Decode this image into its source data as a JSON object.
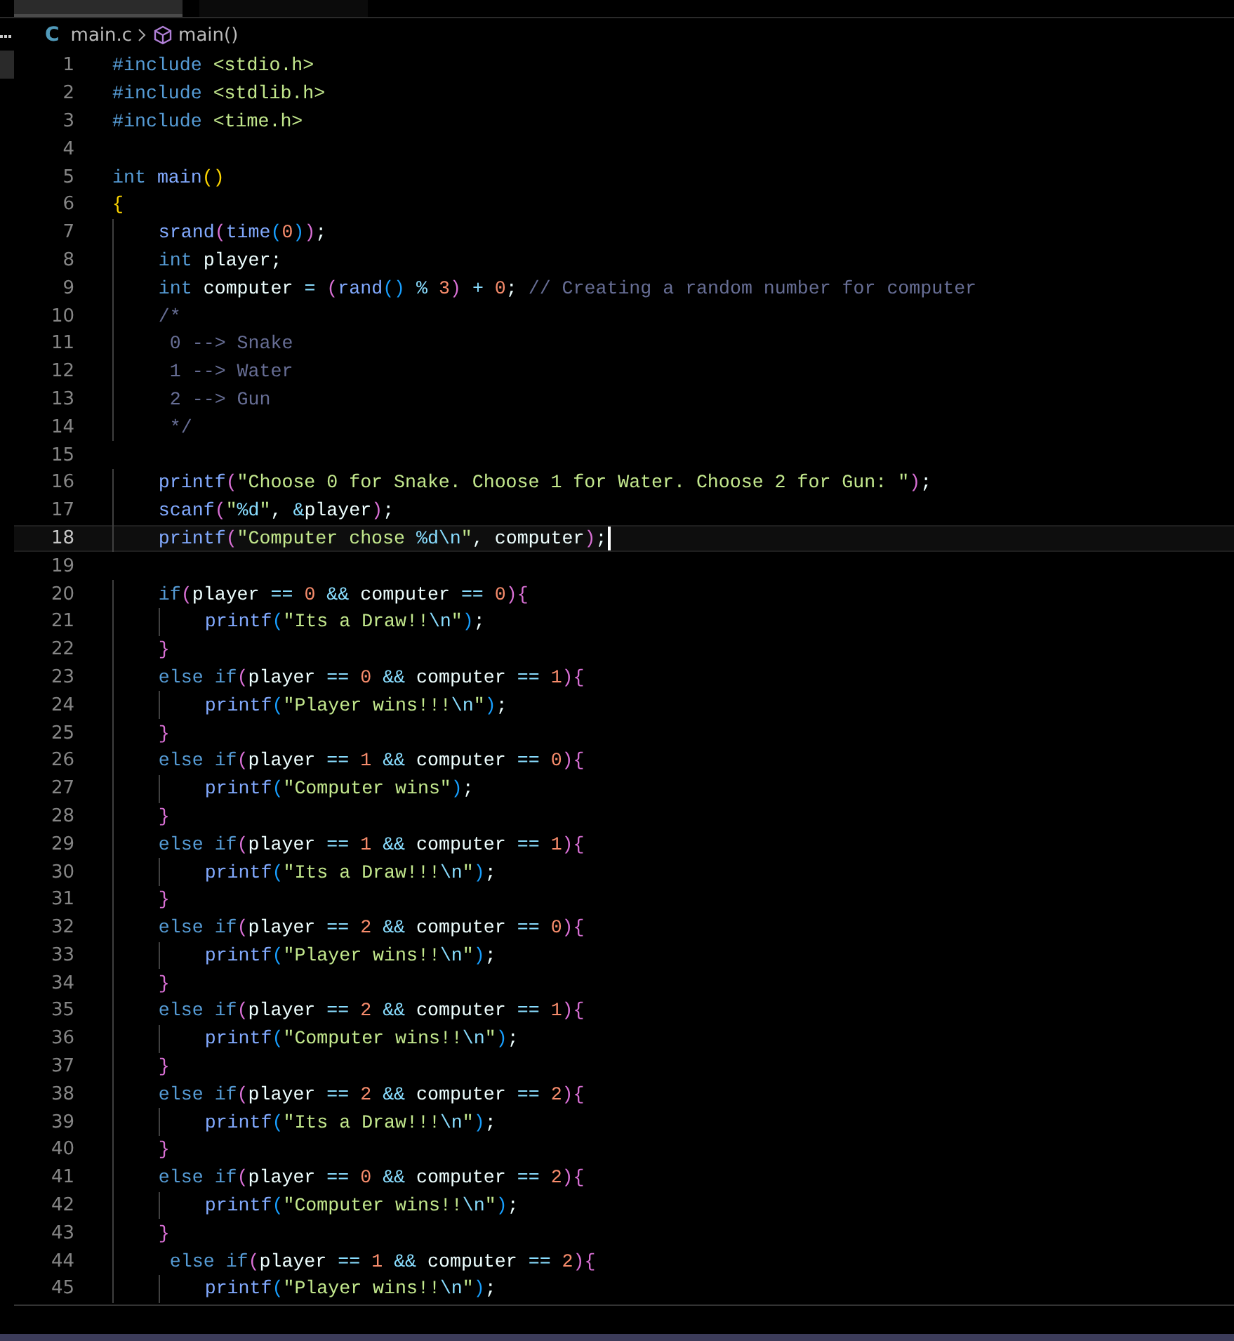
{
  "tabs": [
    {
      "selected": true
    },
    {
      "selected": false
    }
  ],
  "breadcrumb": {
    "language_badge": "C",
    "file": "main.c",
    "symbol": "main()"
  },
  "editor": {
    "lines": [
      {
        "number": "1",
        "text": "#include <stdio.h>",
        "current": false
      },
      {
        "number": "2",
        "text": "#include <stdlib.h>",
        "current": false
      },
      {
        "number": "3",
        "text": "#include <time.h>",
        "current": false
      },
      {
        "number": "4",
        "current": false
      },
      {
        "number": "5",
        "text": "int main()",
        "current": false
      },
      {
        "number": "6",
        "text": "{",
        "current": false
      },
      {
        "number": "7",
        "text": "    srand(time(0));",
        "current": false
      },
      {
        "number": "8",
        "text": "    int player;",
        "current": false
      },
      {
        "number": "9",
        "text": "    int computer = (rand() % 3) + 0; // Creating a random number for computer",
        "current": false
      },
      {
        "number": "10",
        "text": "    /*",
        "current": false
      },
      {
        "number": "11",
        "text": "     0 --> Snake",
        "current": false
      },
      {
        "number": "12",
        "text": "     1 --> Water",
        "current": false
      },
      {
        "number": "13",
        "text": "     2 --> Gun",
        "current": false
      },
      {
        "number": "14",
        "text": "     */",
        "current": false
      },
      {
        "number": "15",
        "current": false
      },
      {
        "number": "16",
        "text": "    printf(\"Choose 0 for Snake. Choose 1 for Water. Choose 2 for Gun: \");",
        "current": false
      },
      {
        "number": "17",
        "text": "    scanf(\"%d\", &player);",
        "current": false
      },
      {
        "number": "18",
        "text": "    printf(\"Computer chose %d\\n\", computer);",
        "current": true
      },
      {
        "number": "19",
        "current": false
      },
      {
        "number": "20",
        "text": "    if(player == 0 && computer == 0){",
        "current": false
      },
      {
        "number": "21",
        "text": "        printf(\"Its a Draw!!\\n\");",
        "current": false
      },
      {
        "number": "22",
        "text": "    }",
        "current": false
      },
      {
        "number": "23",
        "text": "    else if(player == 0 && computer == 1){",
        "current": false
      },
      {
        "number": "24",
        "text": "        printf(\"Player wins!!!\\n\");",
        "current": false
      },
      {
        "number": "25",
        "text": "    }",
        "current": false
      },
      {
        "number": "26",
        "text": "    else if(player == 1 && computer == 0){",
        "current": false
      },
      {
        "number": "27",
        "text": "        printf(\"Computer wins\");",
        "current": false
      },
      {
        "number": "28",
        "text": "    }",
        "current": false
      },
      {
        "number": "29",
        "text": "    else if(player == 1 && computer == 1){",
        "current": false
      },
      {
        "number": "30",
        "text": "        printf(\"Its a Draw!!!\\n\");",
        "current": false
      },
      {
        "number": "31",
        "text": "    }",
        "current": false
      },
      {
        "number": "32",
        "text": "    else if(player == 2 && computer == 0){",
        "current": false
      },
      {
        "number": "33",
        "text": "        printf(\"Player wins!!\\n\");",
        "current": false
      },
      {
        "number": "34",
        "text": "    }",
        "current": false
      },
      {
        "number": "35",
        "text": "    else if(player == 2 && computer == 1){",
        "current": false
      },
      {
        "number": "36",
        "text": "        printf(\"Computer wins!!\\n\");",
        "current": false
      },
      {
        "number": "37",
        "text": "    }",
        "current": false
      },
      {
        "number": "38",
        "text": "    else if(player == 2 && computer == 2){",
        "current": false
      },
      {
        "number": "39",
        "text": "        printf(\"Its a Draw!!!\\n\");",
        "current": false
      },
      {
        "number": "40",
        "text": "    }",
        "current": false
      },
      {
        "number": "41",
        "text": "    else if(player == 0 && computer == 2){",
        "current": false
      },
      {
        "number": "42",
        "text": "        printf(\"Computer wins!!\\n\");",
        "current": false
      },
      {
        "number": "43",
        "text": "    }",
        "current": false
      },
      {
        "number": "44",
        "text": "     else if(player == 1 && computer == 2){",
        "current": false
      },
      {
        "number": "45",
        "text": "        printf(\"Player wins!!\\n\");",
        "current": false
      }
    ]
  }
}
